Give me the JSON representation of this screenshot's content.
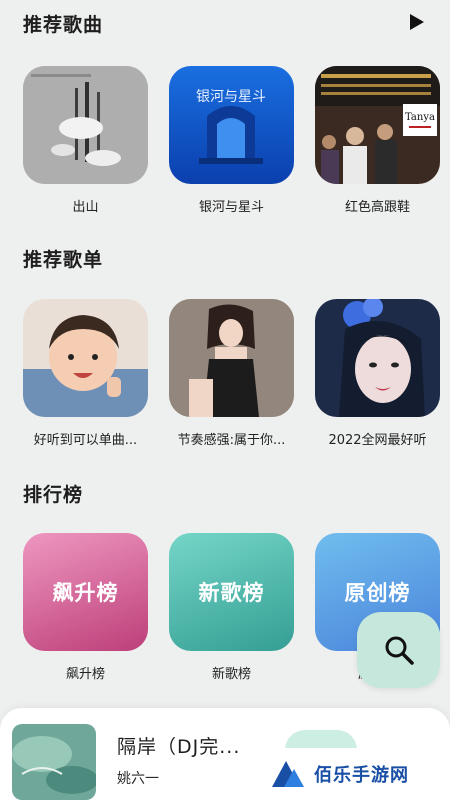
{
  "sections": {
    "songs_title": "推荐歌曲",
    "playlists_title": "推荐歌单",
    "charts_title": "排行榜"
  },
  "songs": [
    {
      "label": "出山"
    },
    {
      "label": "银河与星斗",
      "cover_text": "银河与星斗"
    },
    {
      "label": "红色高跟鞋",
      "cover_text": "Tanya"
    }
  ],
  "playlists": [
    {
      "label": "好听到可以单曲..."
    },
    {
      "label": "节奏感强:属于你..."
    },
    {
      "label": "2022全网最好听"
    }
  ],
  "charts": [
    {
      "cover_text": "飙升榜",
      "label": "飙升榜",
      "colors": [
        "#ea8cb8",
        "#c0447e"
      ]
    },
    {
      "cover_text": "新歌榜",
      "label": "新歌榜",
      "colors": [
        "#6fd2c4",
        "#3aa79b"
      ]
    },
    {
      "cover_text": "原创榜",
      "label": "原创榜",
      "colors": [
        "#6cb6ec",
        "#4a88dd"
      ]
    }
  ],
  "player": {
    "title": "隔岸（DJ完...",
    "artist": "姚六一"
  },
  "watermark": {
    "text": "佰乐手游网"
  },
  "icons": {
    "play_all": "play-icon",
    "search": "search-icon"
  }
}
